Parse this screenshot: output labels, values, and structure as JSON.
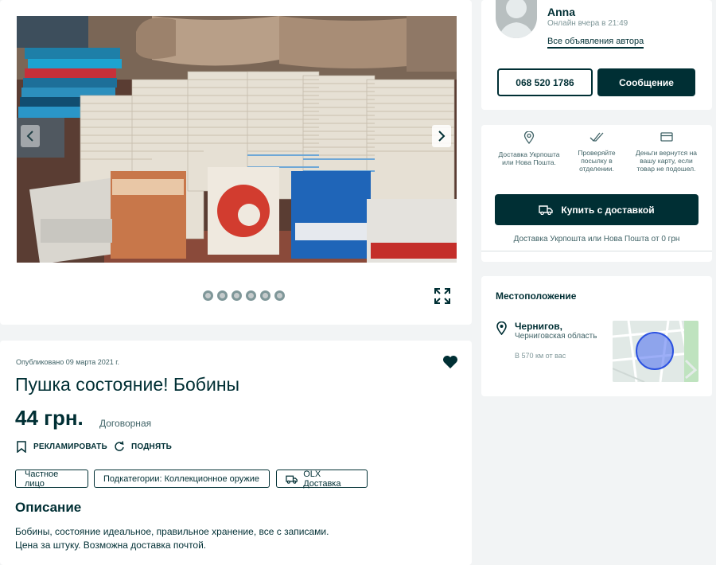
{
  "gallery": {
    "photo_alt": "",
    "dots_count": 6
  },
  "listing": {
    "published": "Опубликовано 09 марта 2021 г.",
    "title": "Пушка состояние! Бобины",
    "price": "44 грн.",
    "price_note": "Договорная",
    "promote_label": "РЕКЛАМИРОВАТЬ",
    "raise_label": "ПОДНЯТЬ",
    "tags": [
      "Частное лицо",
      "Подкатегории: Коллекционное оружие",
      "OLX Доставка"
    ],
    "description_title": "Описание",
    "description_line1": "Бобины, состояние идеальное, правильное хранение, все с записами.",
    "description_line2": "Цена за штуку. Возможна доставка почтой."
  },
  "seller": {
    "name": "Anna",
    "status": "Онлайн вчера в 21:49",
    "all_ads_link": "Все объявления автора",
    "phone": "068 520 1786",
    "message_button": "Сообщение"
  },
  "delivery": {
    "features": [
      {
        "icon": "location-pin-icon",
        "text": "Доставка Укрпошта или Нова Пошта."
      },
      {
        "icon": "double-check-icon",
        "text": "Проверяйте посылку в отделении."
      },
      {
        "icon": "credit-card-icon",
        "text": "Деньги вернутся на вашу карту, если товар не подошел."
      }
    ],
    "buy_button": "Купить с доставкой",
    "note": "Доставка Укрпошта или Нова Пошта от 0 грн"
  },
  "location": {
    "title": "Местоположение",
    "city": "Чернигов,",
    "region": "Черниговская область",
    "distance": "В 570 км от вас"
  },
  "colors": {
    "primary": "#002f34",
    "background": "#f2f4f5",
    "map_circle": "#4a6cf0"
  }
}
